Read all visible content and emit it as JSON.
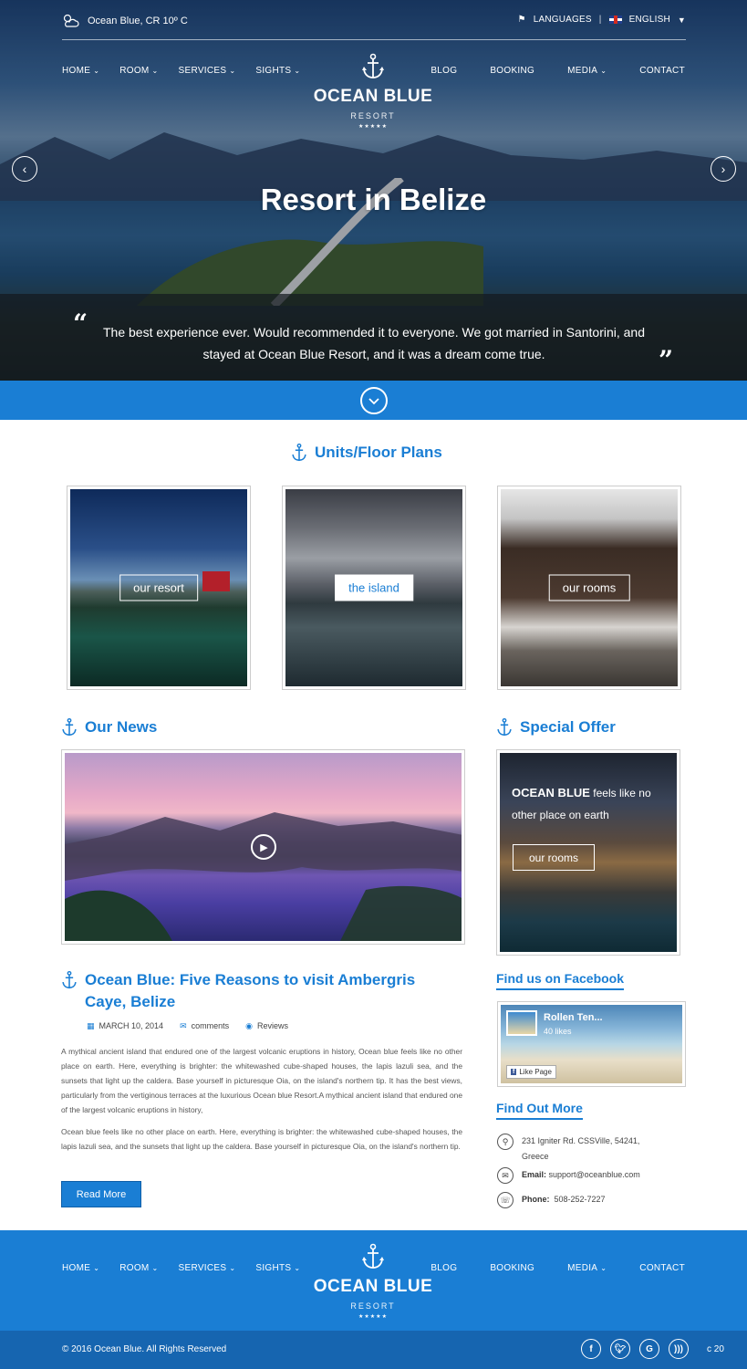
{
  "topbar": {
    "weather_text": "Ocean Blue, CR 10º C",
    "languages_label": "LANGUAGES",
    "current_language": "ENGLISH"
  },
  "nav": {
    "left": [
      "HOME",
      "ROOM",
      "SERVICES",
      "SIGHTS"
    ],
    "right": [
      "BLOG",
      "BOOKING",
      "MEDIA",
      "CONTACT"
    ]
  },
  "logo": {
    "name": "OCEAN BLUE",
    "sub": "RESORT",
    "stars": "★★★★★"
  },
  "hero": {
    "title": "Resort in Belize",
    "quote": "The best experience ever. Would recommended it to everyone. We got married in Santorini, and stayed at Ocean Blue Resort, and it was a dream come true."
  },
  "units": {
    "heading": "Units/Floor Plans",
    "cards": [
      {
        "label": "our resort"
      },
      {
        "label": "the island"
      },
      {
        "label": "our rooms"
      }
    ]
  },
  "news": {
    "heading": "Our News",
    "post_title": "Ocean Blue: Five Reasons to visit Ambergris Caye,  Belize",
    "date": "MARCH 10, 2014",
    "comments": "comments",
    "reviews": "Reviews",
    "paragraph1": "A mythical ancient island that endured one of the largest volcanic eruptions in history, Ocean blue feels like no other place on earth. Here, everything is brighter: the whitewashed cube-shaped houses, the lapis lazuli sea, and the sunsets that light up the caldera. Base yourself in picturesque Oia, on the island's northern tip. It has the best views, particularly from the vertiginous terraces at the luxurious Ocean blue Resort.A mythical ancient island that endured one of the largest volcanic eruptions in history,",
    "paragraph2": "Ocean blue feels like no other place on earth. Here, everything is brighter: the whitewashed cube-shaped houses, the lapis lazuli sea, and the sunsets that light up the caldera. Base yourself in picturesque Oia, on the island's northern tip.",
    "read_more": "Read More"
  },
  "special_offer": {
    "heading": "Special Offer",
    "brand": "OCEAN BLUE",
    "text": " feels like no other place on earth",
    "button": "our rooms"
  },
  "facebook": {
    "heading": "Find us on Facebook",
    "page_name": "Rollen Ten...",
    "likes": "40 likes",
    "like_button": "Like Page"
  },
  "find_out": {
    "heading": "Find Out More",
    "address": "231 Igniter Rd. CSSVille, 54241, Greece",
    "email_label": "Email:",
    "email": "support@oceanblue.com",
    "phone_label": "Phone:",
    "phone": "508-252-7227"
  },
  "footer": {
    "copyright": "© 2016 Ocean Blue. All Rights Reserved",
    "social": [
      "f",
      "t",
      "G",
      "rss"
    ],
    "counter": "c 20"
  },
  "colors": {
    "accent": "#1a7ed4",
    "footer_bar": "#1665b0"
  }
}
